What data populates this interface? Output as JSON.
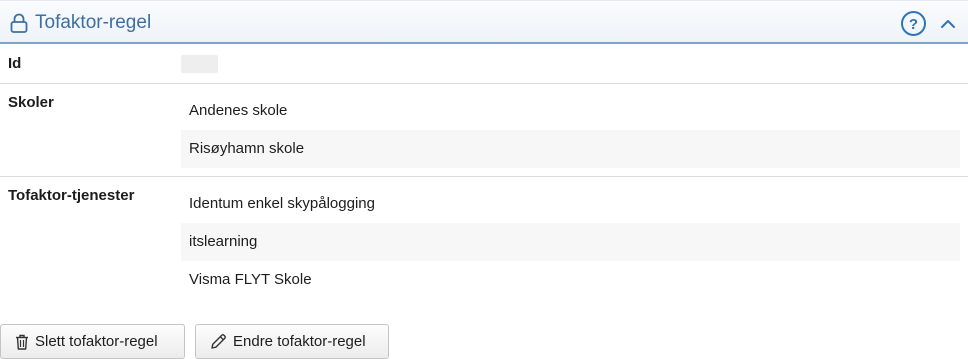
{
  "header": {
    "title": "Tofaktor-regel",
    "icons": {
      "lock": "lock-icon",
      "help": "help-circle-icon",
      "collapse": "chevron-up-icon"
    },
    "accent_color": "#3d6fa1"
  },
  "fields": {
    "id": {
      "label": "Id",
      "value": ""
    },
    "schools": {
      "label": "Skoler",
      "items": [
        "Andenes skole",
        "Risøyhamn skole"
      ]
    },
    "services": {
      "label": "Tofaktor-tjenester",
      "items": [
        "Identum enkel skypålogging",
        "itslearning",
        "Visma FLYT Skole"
      ]
    }
  },
  "actions": {
    "delete_label": "Slett tofaktor-regel",
    "edit_label": "Endre tofaktor-regel",
    "icons": {
      "delete": "trash-icon",
      "edit": "pencil-icon"
    }
  }
}
